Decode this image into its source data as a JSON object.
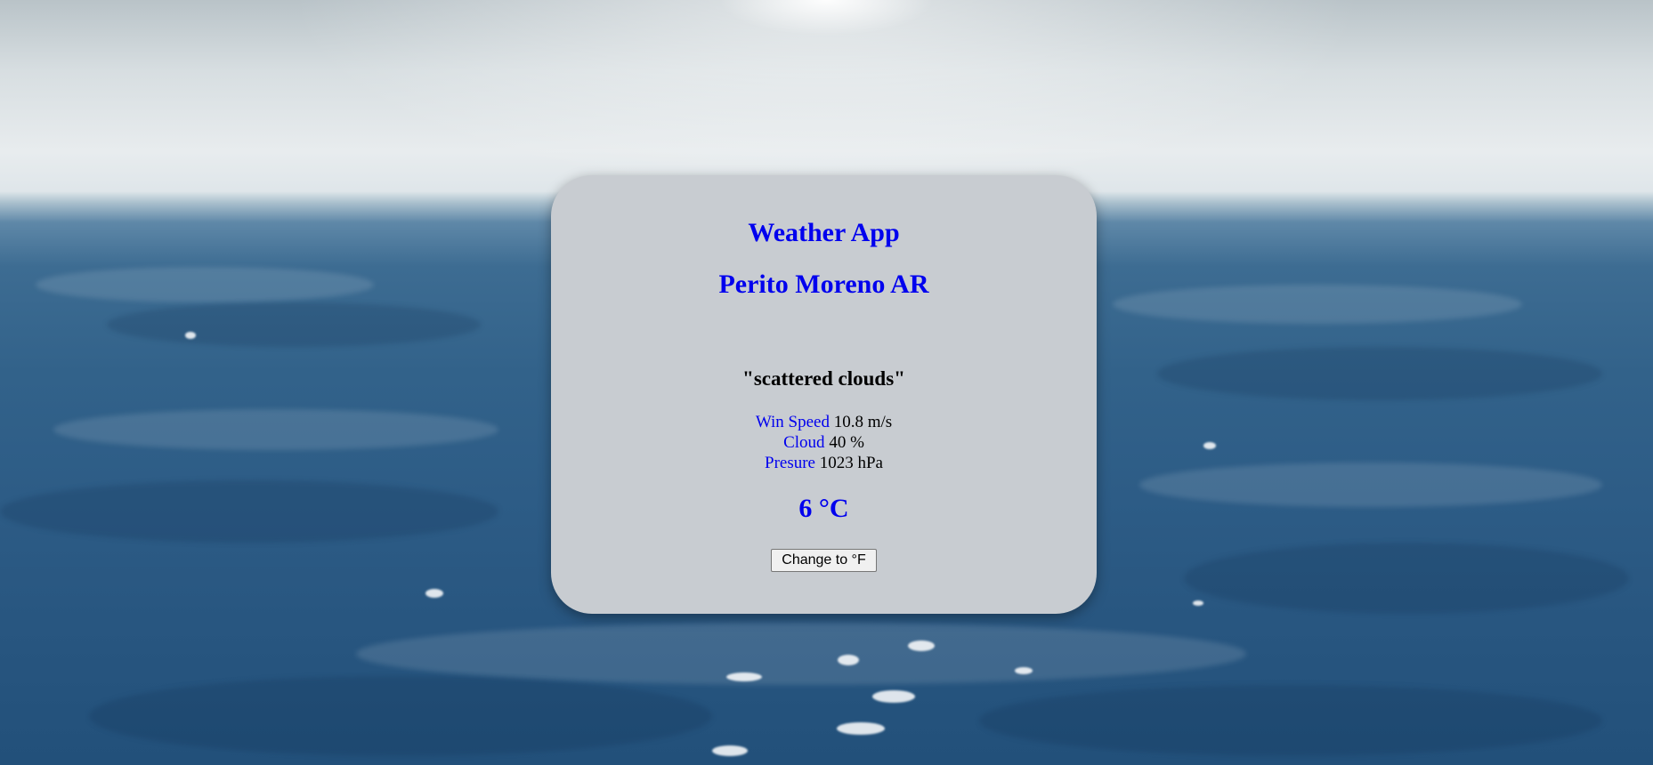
{
  "app": {
    "title": "Weather App"
  },
  "location": {
    "name": "Perito Moreno AR"
  },
  "weather": {
    "description": "\"scattered clouds\"",
    "wind_label": "Win Speed",
    "wind_value": "10.8 m/s",
    "cloud_label": "Cloud",
    "cloud_value": "40 %",
    "pressure_label": "Presure",
    "pressure_value": "1023 hPa",
    "temperature": "6 °C"
  },
  "controls": {
    "toggle_unit_label": "Change to °F"
  },
  "colors": {
    "accent": "#0000ee",
    "card": "#c8ccd1"
  }
}
